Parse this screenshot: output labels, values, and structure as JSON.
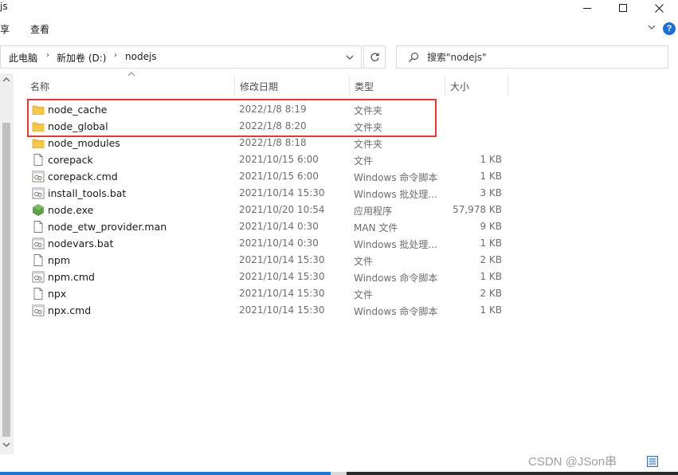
{
  "window": {
    "title": "js"
  },
  "ribbon": {
    "tabs": [
      {
        "label": "享"
      },
      {
        "label": "查看"
      }
    ]
  },
  "address": {
    "crumbs": [
      "此电脑",
      "新加卷 (D:)",
      "nodejs"
    ]
  },
  "search": {
    "placeholder": "搜索\"nodejs\""
  },
  "columns": {
    "name": "名称",
    "date": "修改日期",
    "type": "类型",
    "size": "大小"
  },
  "files": [
    {
      "name": "node_cache",
      "date": "2022/1/8 8:19",
      "type": "文件夹",
      "size": "",
      "icon": "folder-icon"
    },
    {
      "name": "node_global",
      "date": "2022/1/8 8:20",
      "type": "文件夹",
      "size": "",
      "icon": "folder-icon"
    },
    {
      "name": "node_modules",
      "date": "2022/1/8 8:18",
      "type": "文件夹",
      "size": "",
      "icon": "folder-icon"
    },
    {
      "name": "corepack",
      "date": "2021/10/15 6:00",
      "type": "文件",
      "size": "1 KB",
      "icon": "file-icon"
    },
    {
      "name": "corepack.cmd",
      "date": "2021/10/15 6:00",
      "type": "Windows 命令脚本",
      "size": "1 KB",
      "icon": "script-icon"
    },
    {
      "name": "install_tools.bat",
      "date": "2021/10/14 15:30",
      "type": "Windows 批处理...",
      "size": "3 KB",
      "icon": "script-icon"
    },
    {
      "name": "node.exe",
      "date": "2021/10/20 10:54",
      "type": "应用程序",
      "size": "57,978 KB",
      "icon": "nodejs-icon"
    },
    {
      "name": "node_etw_provider.man",
      "date": "2021/10/14 0:30",
      "type": "MAN 文件",
      "size": "9 KB",
      "icon": "file-icon"
    },
    {
      "name": "nodevars.bat",
      "date": "2021/10/14 0:30",
      "type": "Windows 批处理...",
      "size": "1 KB",
      "icon": "script-icon"
    },
    {
      "name": "npm",
      "date": "2021/10/14 15:30",
      "type": "文件",
      "size": "2 KB",
      "icon": "file-icon"
    },
    {
      "name": "npm.cmd",
      "date": "2021/10/14 15:30",
      "type": "Windows 命令脚本",
      "size": "1 KB",
      "icon": "script-icon"
    },
    {
      "name": "npx",
      "date": "2021/10/14 15:30",
      "type": "文件",
      "size": "2 KB",
      "icon": "file-icon"
    },
    {
      "name": "npx.cmd",
      "date": "2021/10/14 15:30",
      "type": "Windows 命令脚本",
      "size": "1 KB",
      "icon": "script-icon"
    }
  ],
  "watermark": "CSDN @JSon串",
  "colors": {
    "highlight": "#e53935",
    "folder": "#f7c94a",
    "node_green": "#5fa04e",
    "accent": "#1f78d1"
  }
}
